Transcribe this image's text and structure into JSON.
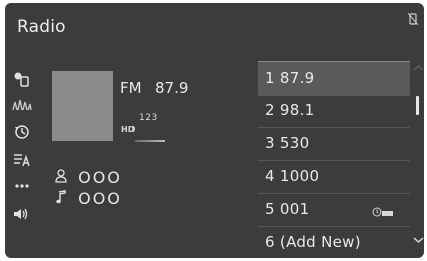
{
  "header": {
    "title": "Radio"
  },
  "sidebar": {
    "items": [
      {
        "icon": "source-icon"
      },
      {
        "icon": "radio-waves-icon",
        "active": true
      },
      {
        "icon": "history-icon"
      },
      {
        "icon": "tune-list-icon"
      },
      {
        "icon": "more-icon",
        "label": "..."
      },
      {
        "icon": "volume-icon"
      }
    ]
  },
  "now_playing": {
    "band": "FM",
    "frequency": "87.9",
    "hd_channel": "123",
    "artist": "OOO",
    "song": "OOO"
  },
  "presets": [
    {
      "label": "1  87.9",
      "selected": true
    },
    {
      "label": "2  98.1"
    },
    {
      "label": "3  530"
    },
    {
      "label": "4  1000"
    },
    {
      "label": "5  001",
      "badge": "sxm"
    },
    {
      "label": "6  (Add New)"
    }
  ],
  "colors": {
    "screen_bg": "#3c3c3c",
    "selected_row": "#5a5a5a",
    "text": "#e8e8e8"
  }
}
